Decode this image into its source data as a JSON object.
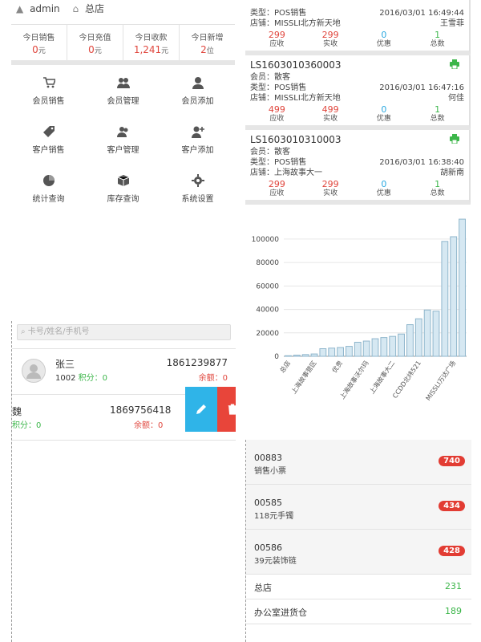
{
  "dashboard": {
    "header": {
      "user": "admin",
      "store": "总店"
    },
    "stats": [
      {
        "label": "今日销售",
        "value": "0",
        "unit": "元"
      },
      {
        "label": "今日充值",
        "value": "0",
        "unit": "元"
      },
      {
        "label": "今日收款",
        "value": "1,241",
        "unit": "元"
      },
      {
        "label": "今日新增",
        "value": "2",
        "unit": "位"
      }
    ],
    "menu": [
      {
        "label": "会员销售",
        "icon": "cart-icon"
      },
      {
        "label": "会员管理",
        "icon": "users-icon"
      },
      {
        "label": "会员添加",
        "icon": "user-icon"
      },
      {
        "label": "客户销售",
        "icon": "tag-icon"
      },
      {
        "label": "客户管理",
        "icon": "group-icon"
      },
      {
        "label": "客户添加",
        "icon": "user-plus-icon"
      },
      {
        "label": "统计查询",
        "icon": "pie-chart-icon"
      },
      {
        "label": "库存查询",
        "icon": "box-icon"
      },
      {
        "label": "系统设置",
        "icon": "gear-icon"
      }
    ]
  },
  "orders": [
    {
      "id": "",
      "member": "",
      "type": "类型：POS销售",
      "time": "2016/03/01 16:49:44",
      "store": "店铺：MISSLI北方新天地",
      "staff": "王雪菲",
      "amounts": [
        "299",
        "299",
        "0",
        "1"
      ]
    },
    {
      "id": "LS1603010360003",
      "member": "会员：散客",
      "type": "类型：POS销售",
      "time": "2016/03/01 16:47:16",
      "store": "店铺：MISSLI北方新天地",
      "staff": "何佳",
      "amounts": [
        "499",
        "499",
        "0",
        "1"
      ]
    },
    {
      "id": "LS1603010310003",
      "member": "会员：散客",
      "type": "类型：POS销售",
      "time": "2016/03/01 16:38:40",
      "store": "店铺：上海故事大一",
      "staff": "胡新南",
      "amounts": [
        "299",
        "299",
        "0",
        "1"
      ]
    }
  ],
  "order_labels": [
    "应收",
    "实收",
    "优惠",
    "总数"
  ],
  "members": {
    "search_placeholder": "卡号/姓名/手机号",
    "rows": [
      {
        "name": "张三",
        "card": "1002",
        "points_label": "积分：0",
        "phone": "1861239877",
        "balance_label": "余额：0"
      },
      {
        "name": "魏",
        "card": "",
        "points_label": "积分：0",
        "phone": "1869756418",
        "balance_label": "余额：0"
      }
    ]
  },
  "products": [
    {
      "code": "00883",
      "name": "销售小票",
      "count": "740"
    },
    {
      "code": "00585",
      "name": "118元手镯",
      "count": "434"
    },
    {
      "code": "00586",
      "name": "39元装饰链",
      "count": "428"
    }
  ],
  "stores": [
    {
      "name": "总店",
      "count": "231"
    },
    {
      "name": "办公室进货仓",
      "count": "189"
    }
  ],
  "colors": {
    "accent_red": "#e0463d",
    "accent_green": "#3cb64a",
    "accent_blue": "#2aa8e0",
    "bar_fill": "#d6e8f2",
    "bar_stroke": "#8fb6cc"
  },
  "chart_data": {
    "type": "bar",
    "categories": [
      "总店",
      "",
      "",
      "上海故事营区",
      "",
      "",
      "优贵",
      "",
      "",
      "上海故事沃尔玛",
      "",
      "",
      "上海故事大二",
      "",
      "",
      "CCDD北纬521",
      "",
      "",
      "",
      "MISSLI万达广场",
      ""
    ],
    "values": [
      500,
      1000,
      1500,
      2000,
      6500,
      7000,
      7500,
      8500,
      12000,
      13000,
      15000,
      16000,
      17000,
      19000,
      27000,
      32000,
      39500,
      38500,
      98000,
      102000,
      117000
    ],
    "ylim": [
      0,
      115000
    ],
    "yticks": [
      "0",
      "20000",
      "40000",
      "60000",
      "80000",
      "100000"
    ],
    "ytick_values": [
      0,
      20000,
      40000,
      60000,
      80000,
      100000
    ],
    "grid": true
  }
}
